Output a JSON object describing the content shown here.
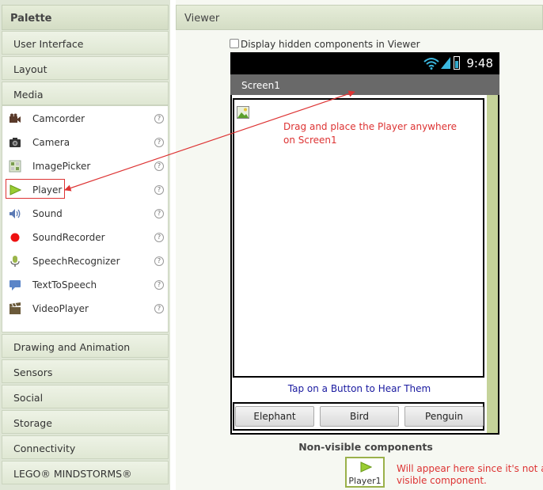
{
  "palette": {
    "title": "Palette",
    "categories_top": [
      "User Interface",
      "Layout",
      "Media"
    ],
    "media_items": [
      {
        "label": "Camcorder",
        "icon": "camcorder-icon"
      },
      {
        "label": "Camera",
        "icon": "camera-icon"
      },
      {
        "label": "ImagePicker",
        "icon": "image-picker-icon"
      },
      {
        "label": "Player",
        "icon": "player-icon"
      },
      {
        "label": "Sound",
        "icon": "sound-icon"
      },
      {
        "label": "SoundRecorder",
        "icon": "sound-recorder-icon"
      },
      {
        "label": "SpeechRecognizer",
        "icon": "speech-recognizer-icon"
      },
      {
        "label": "TextToSpeech",
        "icon": "text-to-speech-icon"
      },
      {
        "label": "VideoPlayer",
        "icon": "video-player-icon"
      }
    ],
    "help_glyph": "?",
    "categories_bottom": [
      "Drawing and Animation",
      "Sensors",
      "Social",
      "Storage",
      "Connectivity",
      "LEGO® MINDSTORMS®"
    ]
  },
  "viewer": {
    "title": "Viewer",
    "display_hidden_label": "Display hidden components in Viewer",
    "status_time": "9:48",
    "screen_title": "Screen1",
    "drag_note": "Drag and place the Player anywhere on Screen1",
    "tap_label": "Tap on a Button to Hear Them",
    "buttons": [
      "Elephant",
      "Bird",
      "Penguin"
    ],
    "nonvisible_title": "Non-visible components",
    "nonvisible_item": "Player1",
    "nonvisible_note": "Will appear here since it's not a visible component."
  },
  "colors": {
    "annotation_red": "#dd3333",
    "tap_label_blue": "#1a1aa0",
    "scrollbar_green": "#c5d39a"
  }
}
